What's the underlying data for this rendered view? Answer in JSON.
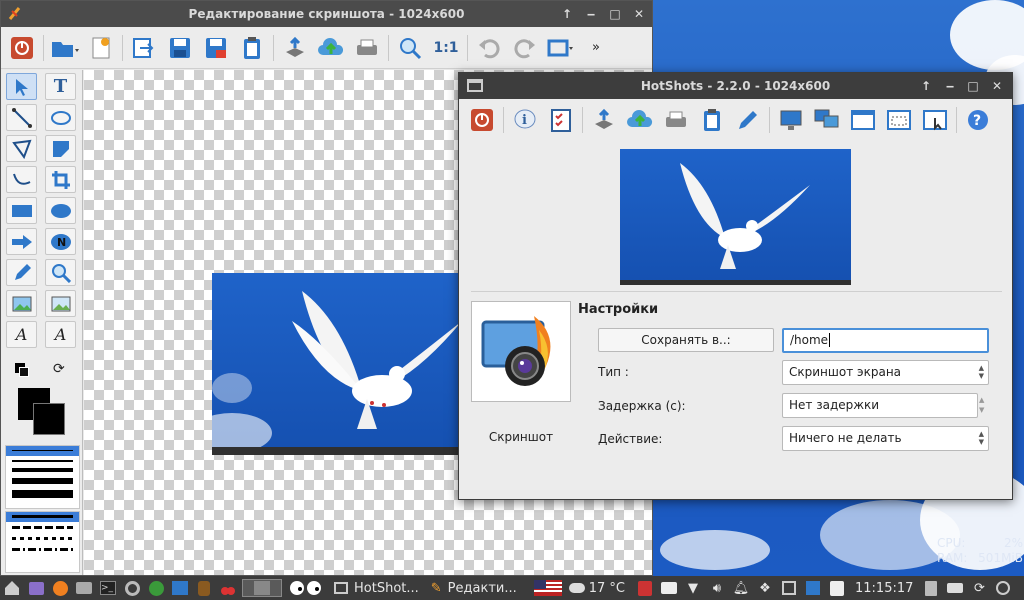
{
  "editor": {
    "title": "Редактирование скриншота - 1024x600"
  },
  "hotshots": {
    "title": "HotShots - 2.2.0 - 1024x600",
    "settings_title": "Настройки",
    "save_button": "Сохранять в..:",
    "save_path": "/home",
    "type_label": "Тип :",
    "type_value": "Скриншот экрана",
    "delay_label": "Задержка (с):",
    "delay_value": "Нет задержки",
    "action_label": "Действие:",
    "action_value": "Ничего не делать",
    "icon_label": "Скриншот"
  },
  "sysmon": {
    "cpu_label": "CPU:",
    "cpu_value": "2%",
    "ram_label": "RAM:",
    "ram_value": "501MiB"
  },
  "taskbar": {
    "task_hotshots": "HotShot...",
    "task_editor": "Редакти...",
    "weather": "17 °C",
    "clock": "11:15:17"
  },
  "colors": {
    "desktop_blue": "#1c5bc3",
    "titlebar": "#4b4b4b",
    "taskbar": "#3b3b3b",
    "accent": "#4a90d9"
  }
}
